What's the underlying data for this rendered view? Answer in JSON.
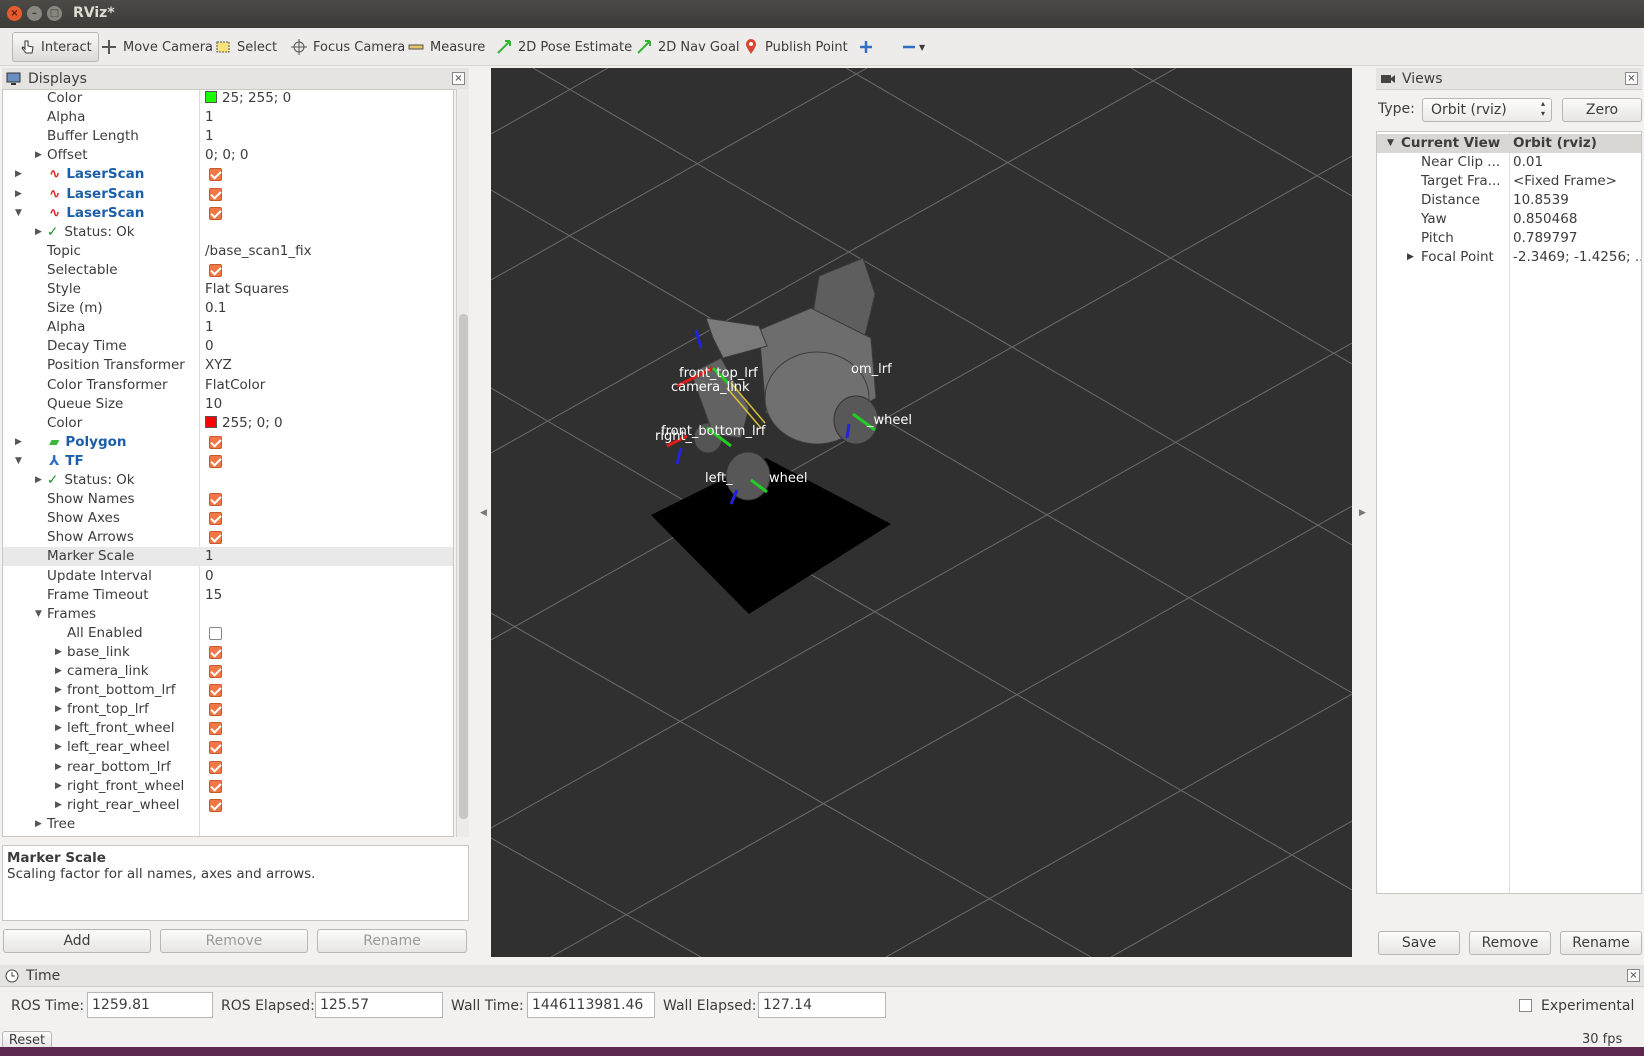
{
  "window": {
    "title": "RViz*"
  },
  "toolbar": {
    "tools": [
      "Interact",
      "Move Camera",
      "Select",
      "Focus Camera",
      "Measure",
      "2D Pose Estimate",
      "2D Nav Goal",
      "Publish Point"
    ]
  },
  "displays": {
    "title": "Displays",
    "rows": [
      {
        "name": "Color",
        "value": "25; 255; 0",
        "swatch": "#19ff00"
      },
      {
        "name": "Alpha",
        "value": "1"
      },
      {
        "name": "Buffer Length",
        "value": "1"
      },
      {
        "name": "Offset",
        "value": "0; 0; 0"
      },
      {
        "name": "LaserScan"
      },
      {
        "name": "LaserScan"
      },
      {
        "name": "LaserScan"
      },
      {
        "name": "Status: Ok"
      },
      {
        "name": "Topic",
        "value": "/base_scan1_fix"
      },
      {
        "name": "Selectable"
      },
      {
        "name": "Style",
        "value": "Flat Squares"
      },
      {
        "name": "Size (m)",
        "value": "0.1"
      },
      {
        "name": "Alpha",
        "value": "1"
      },
      {
        "name": "Decay Time",
        "value": "0"
      },
      {
        "name": "Position Transformer",
        "value": "XYZ"
      },
      {
        "name": "Color Transformer",
        "value": "FlatColor"
      },
      {
        "name": "Queue Size",
        "value": "10"
      },
      {
        "name": "Color",
        "value": "255; 0; 0",
        "swatch": "#ff0000"
      },
      {
        "name": "Polygon"
      },
      {
        "name": "TF"
      },
      {
        "name": "Status: Ok"
      },
      {
        "name": "Show Names"
      },
      {
        "name": "Show Axes"
      },
      {
        "name": "Show Arrows"
      },
      {
        "name": "Marker Scale",
        "value": "1"
      },
      {
        "name": "Update Interval",
        "value": "0"
      },
      {
        "name": "Frame Timeout",
        "value": "15"
      },
      {
        "name": "Frames"
      },
      {
        "name": "All Enabled"
      },
      {
        "name": "base_link"
      },
      {
        "name": "camera_link"
      },
      {
        "name": "front_bottom_lrf"
      },
      {
        "name": "front_top_lrf"
      },
      {
        "name": "left_front_wheel"
      },
      {
        "name": "left_rear_wheel"
      },
      {
        "name": "rear_bottom_lrf"
      },
      {
        "name": "right_front_wheel"
      },
      {
        "name": "right_rear_wheel"
      },
      {
        "name": "Tree"
      }
    ],
    "help_title": "Marker Scale",
    "help_text": "Scaling factor for all names, axes and arrows.",
    "buttons": {
      "add": "Add",
      "remove": "Remove",
      "rename": "Rename"
    }
  },
  "viewport": {
    "labels": [
      "front_top_lrf",
      "camera_link",
      "front_bottom_lrf",
      "right_",
      "om_lrf",
      "_wheel",
      "left_",
      "wheel"
    ]
  },
  "views": {
    "title": "Views",
    "type_label": "Type:",
    "type_value": "Orbit (rviz)",
    "zero": "Zero",
    "header_name": "Current View",
    "header_value": "Orbit (rviz)",
    "rows": [
      {
        "name": "Near Clip ...",
        "value": "0.01"
      },
      {
        "name": "Target Fra...",
        "value": "<Fixed Frame>"
      },
      {
        "name": "Distance",
        "value": "10.8539"
      },
      {
        "name": "Yaw",
        "value": "0.850468"
      },
      {
        "name": "Pitch",
        "value": "0.789797"
      },
      {
        "name": "Focal Point",
        "value": "-2.3469; -1.4256; ..."
      }
    ],
    "buttons": {
      "save": "Save",
      "remove": "Remove",
      "rename": "Rename"
    }
  },
  "time": {
    "title": "Time",
    "ros_time_label": "ROS Time:",
    "ros_time": "1259.81",
    "ros_elapsed_label": "ROS Elapsed:",
    "ros_elapsed": "125.57",
    "wall_time_label": "Wall Time:",
    "wall_time": "1446113981.46",
    "wall_elapsed_label": "Wall Elapsed:",
    "wall_elapsed": "127.14",
    "experimental": "Experimental",
    "reset": "Reset",
    "fps": "30 fps"
  }
}
